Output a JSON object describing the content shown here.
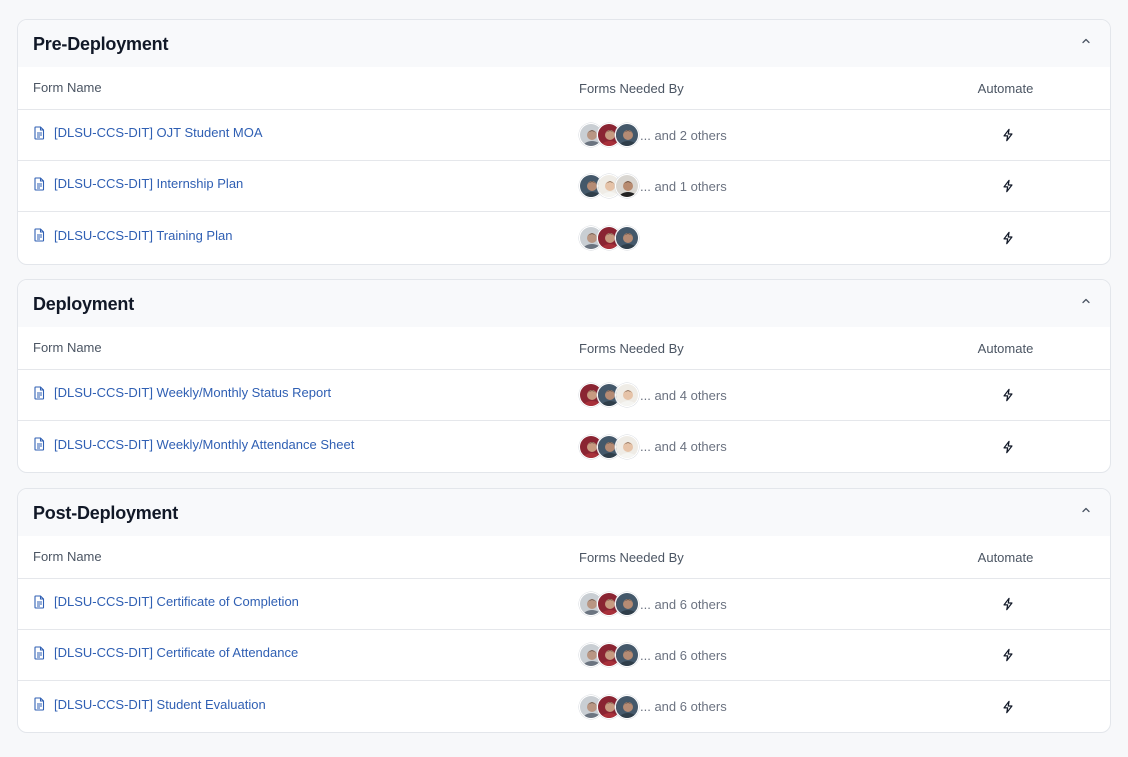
{
  "columns": {
    "form_name": "Form Name",
    "needed_by": "Forms Needed By",
    "automate": "Automate"
  },
  "colors": {
    "link": "#2f5fb3",
    "avatar_palette": [
      "#8a9aa8",
      "#a8303a",
      "#3f5160",
      "#e7e2d8",
      "#2c3a44"
    ]
  },
  "sections": [
    {
      "title": "Pre-Deployment",
      "rows": [
        {
          "name": "[DLSU-CCS-DIT] OJT Student MOA",
          "avatars": [
            "grey",
            "red",
            "teal"
          ],
          "others": "... and 2 others"
        },
        {
          "name": "[DLSU-CCS-DIT] Internship Plan",
          "avatars": [
            "teal",
            "light",
            "dark"
          ],
          "others": "... and 1 others"
        },
        {
          "name": "[DLSU-CCS-DIT] Training Plan",
          "avatars": [
            "grey",
            "red",
            "teal"
          ],
          "others": ""
        }
      ]
    },
    {
      "title": "Deployment",
      "rows": [
        {
          "name": "[DLSU-CCS-DIT] Weekly/Monthly Status Report",
          "avatars": [
            "red",
            "teal",
            "light"
          ],
          "others": "... and 4 others"
        },
        {
          "name": "[DLSU-CCS-DIT] Weekly/Monthly Attendance Sheet",
          "avatars": [
            "red",
            "teal",
            "light"
          ],
          "others": "... and 4 others"
        }
      ]
    },
    {
      "title": "Post-Deployment",
      "rows": [
        {
          "name": "[DLSU-CCS-DIT] Certificate of Completion",
          "avatars": [
            "grey",
            "red",
            "teal"
          ],
          "others": "... and 6 others"
        },
        {
          "name": "[DLSU-CCS-DIT] Certificate of Attendance",
          "avatars": [
            "grey",
            "red",
            "teal"
          ],
          "others": "... and 6 others"
        },
        {
          "name": "[DLSU-CCS-DIT] Student Evaluation",
          "avatars": [
            "grey",
            "red",
            "teal"
          ],
          "others": "... and 6 others"
        }
      ]
    }
  ]
}
